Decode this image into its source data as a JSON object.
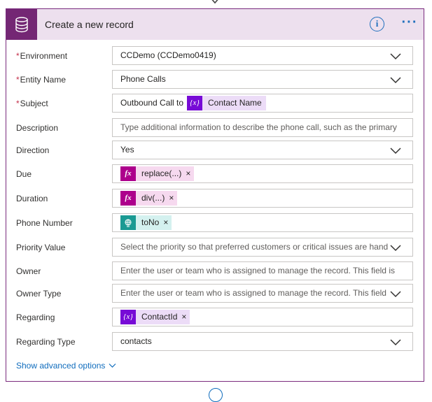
{
  "header": {
    "title": "Create a new record",
    "icon": "database-icon",
    "info_label": "i",
    "more_label": "···",
    "accent": "#742774"
  },
  "fields": {
    "environment": {
      "label": "Environment",
      "required": "*",
      "value": "CCDemo (CCDemo0419)"
    },
    "entity_name": {
      "label": "Entity Name",
      "required": "*",
      "value": "Phone Calls"
    },
    "subject": {
      "label": "Subject",
      "required": "*",
      "prefix": "Outbound Call to",
      "token": "Contact Name",
      "token_icon": "{x}"
    },
    "description": {
      "label": "Description",
      "placeholder": "Type additional information to describe the phone call, such as the primary"
    },
    "direction": {
      "label": "Direction",
      "value": "Yes"
    },
    "due": {
      "label": "Due",
      "token": "replace(...)",
      "token_icon": "fx"
    },
    "duration": {
      "label": "Duration",
      "token": "div(...)",
      "token_icon": "fx"
    },
    "phone_number": {
      "label": "Phone Number",
      "token": "toNo",
      "token_icon": "globe-icon"
    },
    "priority_value": {
      "label": "Priority Value",
      "placeholder": "Select the priority so that preferred customers or critical issues are hand"
    },
    "owner": {
      "label": "Owner",
      "placeholder": "Enter the user or team who is assigned to manage the record. This field is"
    },
    "owner_type": {
      "label": "Owner Type",
      "placeholder": "Enter the user or team who is assigned to manage the record. This field"
    },
    "regarding": {
      "label": "Regarding",
      "token": "ContactId",
      "token_icon": "{x}"
    },
    "regarding_type": {
      "label": "Regarding Type",
      "value": "contacts"
    }
  },
  "token_remove": "×",
  "show_advanced": "Show advanced options"
}
